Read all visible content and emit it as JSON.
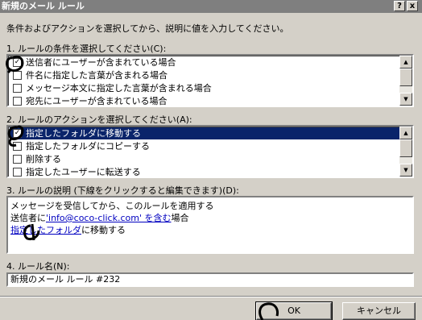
{
  "window": {
    "title": "新規のメール ルール",
    "help_label": "?",
    "close_label": "x"
  },
  "instruction": "条件およびアクションを選択してから、説明に値を入力してください。",
  "conditions": {
    "label": "1. ルールの条件を選択してください(C):",
    "items": [
      {
        "label": "送信者にユーザーが含まれている場合",
        "checked": true
      },
      {
        "label": "件名に指定した言葉が含まれる場合",
        "checked": false
      },
      {
        "label": "メッセージ本文に指定した言葉が含まれる場合",
        "checked": false
      },
      {
        "label": "宛先にユーザーが含まれている場合",
        "checked": false
      }
    ]
  },
  "actions": {
    "label": "2. ルールのアクションを選択してください(A):",
    "items": [
      {
        "label": "指定したフォルダに移動する",
        "checked": true,
        "selected": true
      },
      {
        "label": "指定したフォルダにコピーする",
        "checked": false
      },
      {
        "label": "削除する",
        "checked": false
      },
      {
        "label": "指定したユーザーに転送する",
        "checked": false
      }
    ]
  },
  "description": {
    "label": "3. ルールの説明 (下線をクリックすると編集できます)(D):",
    "line1": "メッセージを受信してから、このルールを適用する",
    "line2_prefix": "送信者に",
    "line2_link": "'info@coco-click.com' を含む",
    "line2_suffix": "場合",
    "line3_link": "指定したフォルダ",
    "line3_suffix": "に移動する"
  },
  "rule_name": {
    "label": "4. ルール名(N):",
    "value": "新規のメール ルール #232"
  },
  "buttons": {
    "ok": "OK",
    "cancel": "キャンセル"
  },
  "colors": {
    "selection": "#0a246a",
    "link": "#0000c0",
    "ink": "#000000"
  }
}
